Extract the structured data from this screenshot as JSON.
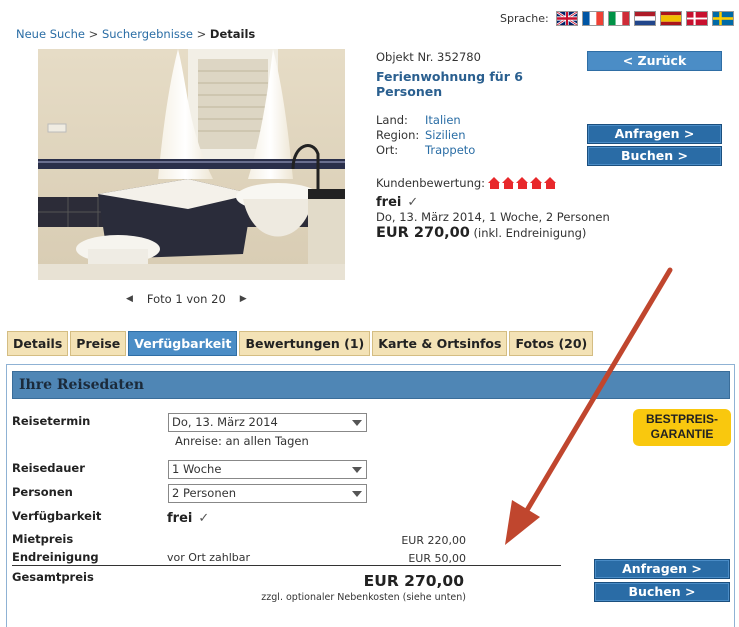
{
  "lang": {
    "label": "Sprache:",
    "flags": [
      "english-flag",
      "french-flag",
      "italian-flag",
      "dutch-flag",
      "spanish-flag",
      "danish-flag",
      "swedish-flag"
    ]
  },
  "breadcrumb": {
    "items": [
      "Neue Suche",
      "Suchergebnisse",
      "Details"
    ],
    "sep": ">"
  },
  "gallery": {
    "caption": "Foto 1 von 20",
    "prev": "◀",
    "next": "▶"
  },
  "object": {
    "nr": "Objekt Nr. 352780",
    "title": "Ferienwohnung für 6 Personen",
    "land_label": "Land:",
    "land": "Italien",
    "region_label": "Region:",
    "region": "Sizilien",
    "ort_label": "Ort:",
    "ort": "Trappeto",
    "rating_label": "Kundenbewertung:",
    "rating_value": 5,
    "status": "frei",
    "check": "✓",
    "availability": "Do, 13. März 2014, 1 Woche, 2 Personen",
    "price": "EUR 270,00",
    "price_note": "(inkl. Endreinigung)"
  },
  "buttons": {
    "back": "< Zurück",
    "request": "Anfragen >",
    "book": "Buchen >"
  },
  "tabs": [
    {
      "label": "Details",
      "active": false
    },
    {
      "label": "Preise",
      "active": false
    },
    {
      "label": "Verfügbarkeit",
      "active": true
    },
    {
      "label": "Bewertungen (1)",
      "active": false
    },
    {
      "label": "Karte & Ortsinfos",
      "active": false
    },
    {
      "label": "Fotos (20)",
      "active": false
    }
  ],
  "panel": {
    "title": "Ihre Reisedaten",
    "reisetermin_label": "Reisetermin",
    "reisetermin_value": "Do, 13. März 2014",
    "anreise": "Anreise: an allen Tagen",
    "reisedauer_label": "Reisedauer",
    "reisedauer_value": "1 Woche",
    "personen_label": "Personen",
    "personen_value": "2 Personen",
    "verfuegbarkeit_label": "Verfügbarkeit",
    "verfuegbarkeit_value": "frei",
    "mietpreis_label": "Mietpreis",
    "mietpreis_value": "EUR 220,00",
    "endreinigung_label": "Endreinigung",
    "endreinigung_note": "vor Ort zahlbar",
    "endreinigung_value": "EUR 50,00",
    "gesamtpreis_label": "Gesamtpreis",
    "gesamtpreis_value": "EUR 270,00",
    "gesamtpreis_note": "zzgl. optionaler Nebenkosten (siehe unten)",
    "badge_line1": "BESTPREIS-",
    "badge_line2": "GARANTIE"
  },
  "colors": {
    "button_blue": "#2a6ca6",
    "tab_active": "#4b8dc6",
    "tab_inactive": "#f3e2b6",
    "badge_yellow": "#f9c80e",
    "rating_red": "#e8282b",
    "annotation_arrow": "#c0462e"
  }
}
